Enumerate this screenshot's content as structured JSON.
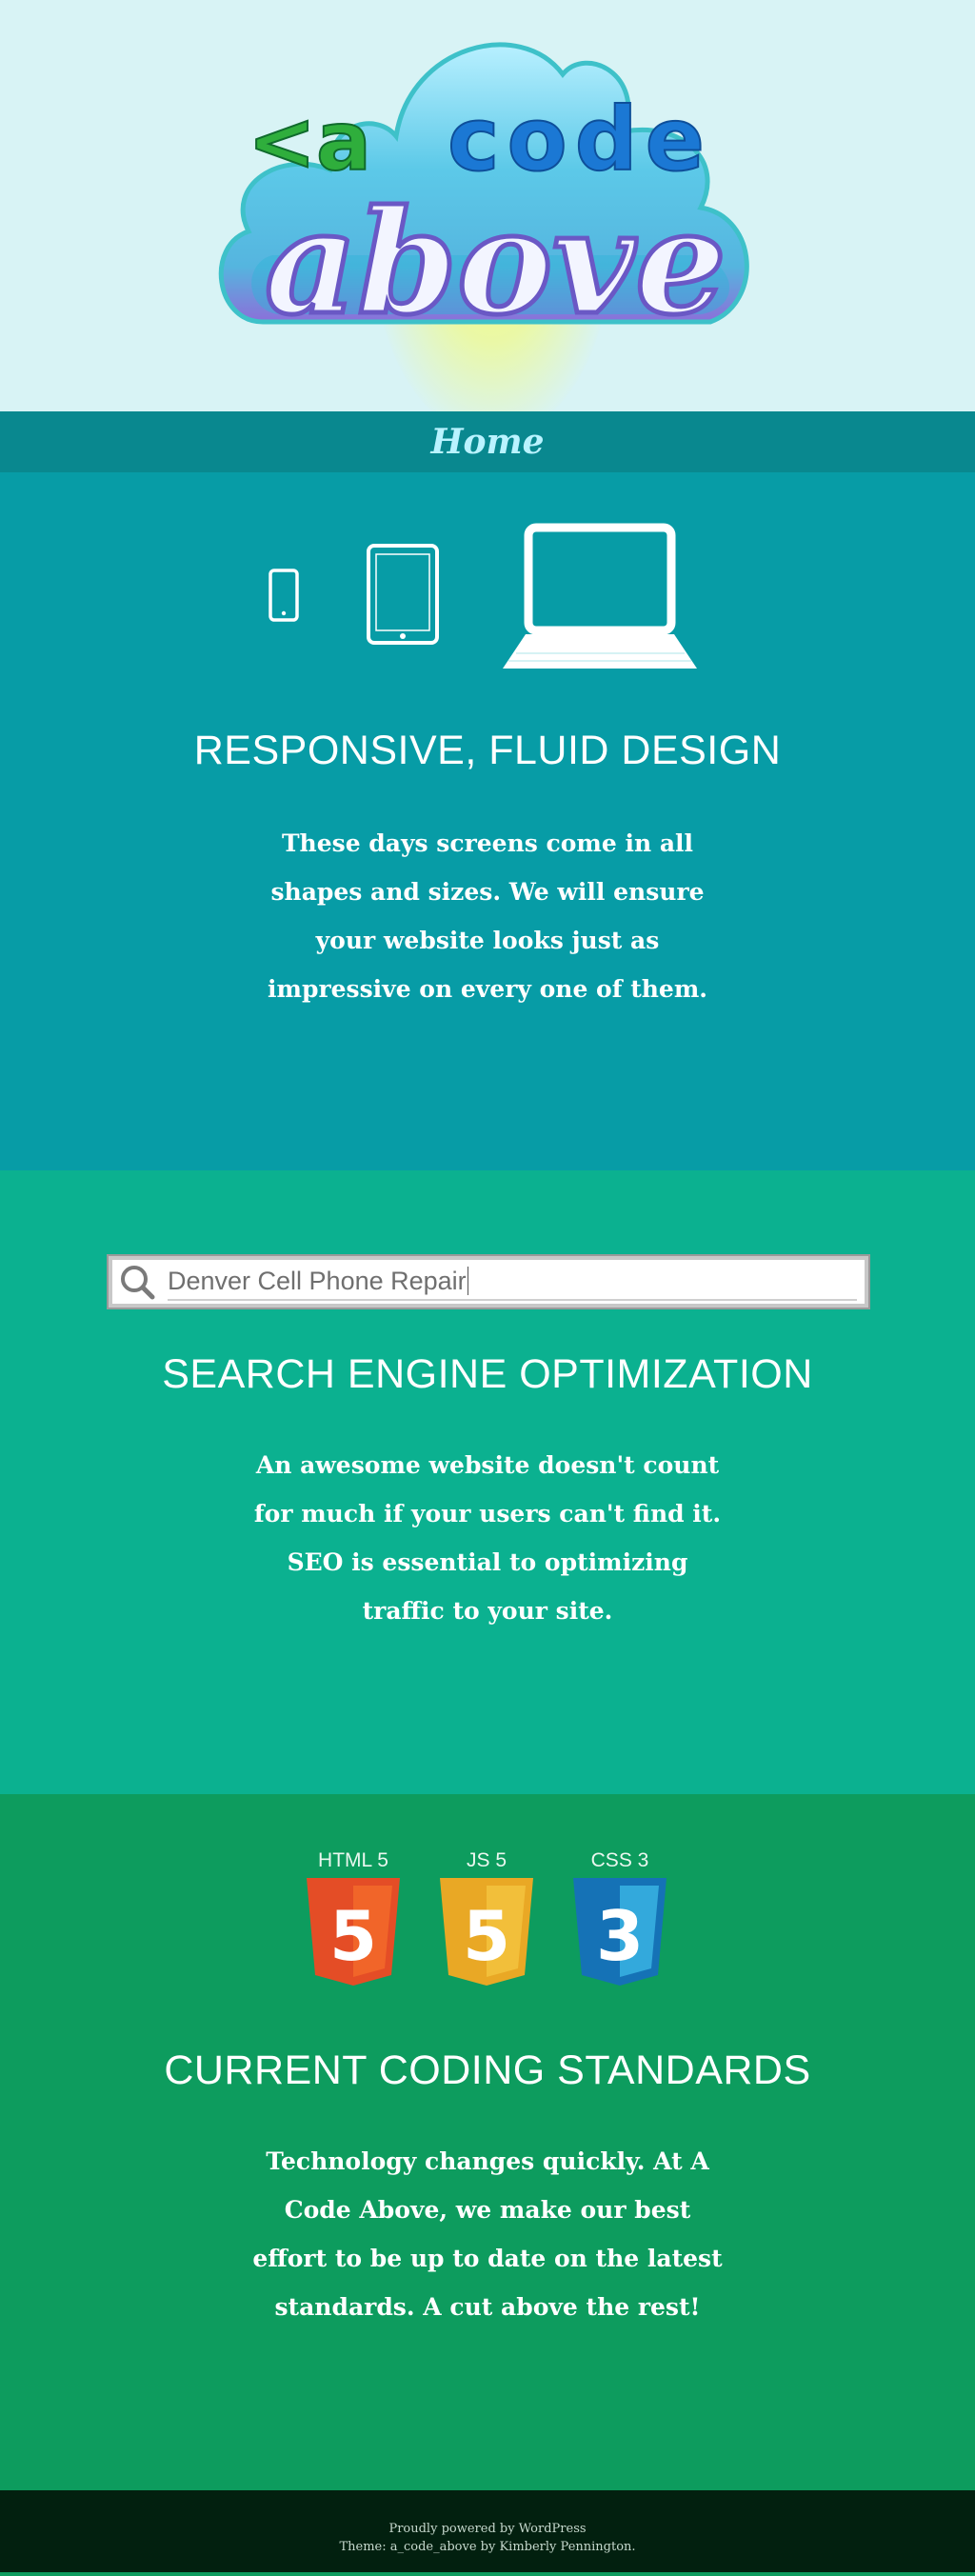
{
  "logo": {
    "line1": "<a",
    "line1b": "code",
    "line2": "above"
  },
  "nav": {
    "home": "Home"
  },
  "sections": [
    {
      "icon": "devices-icon",
      "title": "RESPONSIVE, FLUID DESIGN",
      "body": "These days screens come in all shapes and sizes. We will ensure your website looks just as impressive on every one of them."
    },
    {
      "search_value": "Denver Cell Phone Repair",
      "title": "SEARCH ENGINE OPTIMIZATION",
      "body": "An awesome website doesn't count for much if your users can't find it. SEO is essential to optimizing traffic to your site."
    },
    {
      "badges": [
        {
          "label": "HTML 5",
          "glyph": "5",
          "color": "#e44d26"
        },
        {
          "label": "JS 5",
          "glyph": "5",
          "color": "#e9a825"
        },
        {
          "label": "CSS 3",
          "glyph": "3",
          "color": "#1572b6"
        }
      ],
      "title": "CURRENT CODING STANDARDS",
      "body": "Technology changes quickly. At A Code Above, we make our best effort to be up to date on the latest standards. A cut above the rest!"
    }
  ],
  "footer": {
    "powered_prefix": "Proudly powered by ",
    "powered_link": "WordPress",
    "theme_prefix": "Theme: a_code_above by ",
    "theme_link": "Kimberly Pennington",
    "theme_suffix": "."
  },
  "colors": {
    "header_bg": "#d8f3f5",
    "nav_bg": "#09888f",
    "section1_bg": "#079ca6",
    "section2_bg": "#0bb190",
    "section3_bg": "#0d9c5e",
    "footer_bg": "#02200f"
  }
}
